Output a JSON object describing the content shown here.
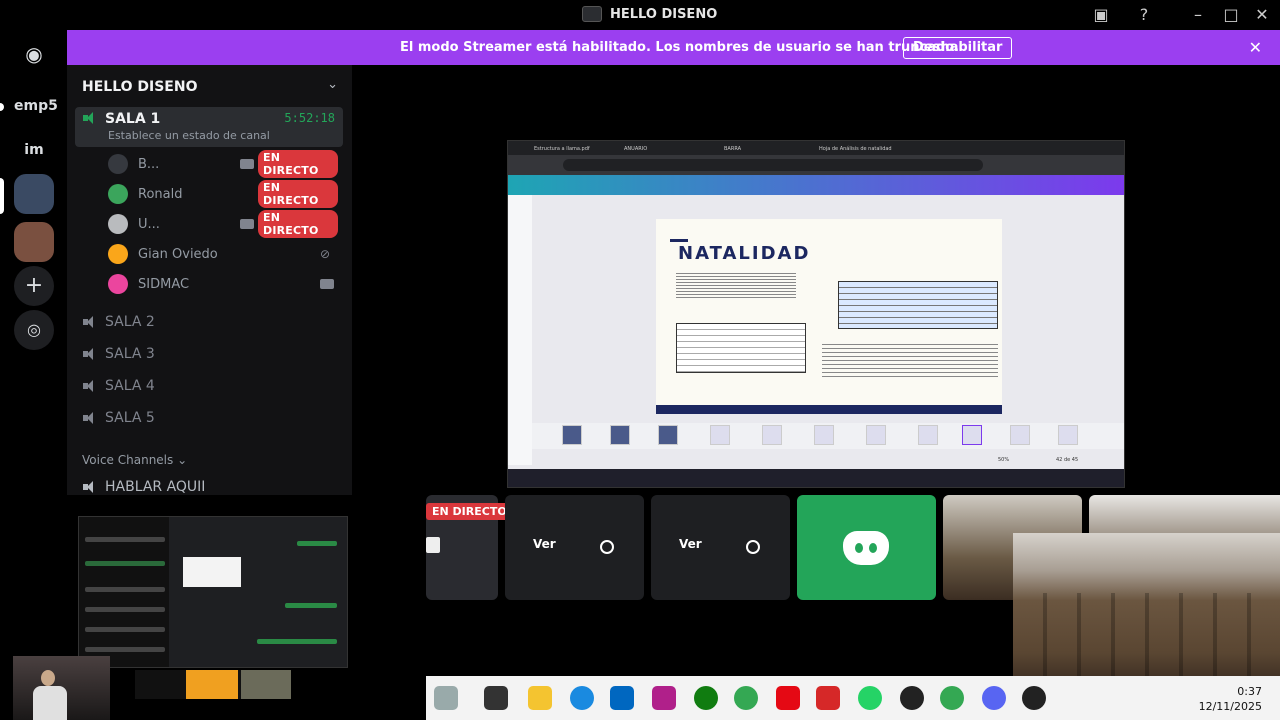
{
  "window": {
    "title": "HELLO DISENO"
  },
  "streamer_banner": {
    "message": "El modo Streamer está habilitado. Los nombres de usuario se han truncado.",
    "button": "Deshabilitar"
  },
  "guilds": [
    {
      "label": "emp5"
    },
    {
      "label": "im"
    }
  ],
  "server": {
    "name": "HELLO DISENO"
  },
  "voice_channels": {
    "active": {
      "name": "SALA 1",
      "timer": "5:52:18",
      "status": "Establece un estado de canal"
    },
    "others": [
      "SALA 2",
      "SALA 3",
      "SALA 4",
      "SALA 5"
    ],
    "category": "Voice Channels",
    "extra": "HABLAR AQUII"
  },
  "users": [
    {
      "name": "B...",
      "live": "EN DIRECTO",
      "avatar_color": "#36393f"
    },
    {
      "name": "Ronald",
      "live": "EN DIRECTO",
      "avatar_color": "#3ba55c"
    },
    {
      "name": "U...",
      "live": "EN DIRECTO",
      "avatar_color": "#b9bbbe"
    },
    {
      "name": "Gian Oviedo",
      "live": "",
      "avatar_color": "#faa61a"
    },
    {
      "name": "SIDMAC",
      "live": "",
      "avatar_color": "#eb459e"
    }
  ],
  "shared_screen": {
    "slide_title": "NATALIDAD",
    "browser_tabs": [
      "Estructura a llama.pdf",
      "ANUARIO",
      "BARRA",
      "Hoja de Análisis de natalidad"
    ],
    "zoom": "50%",
    "pages": "42 de 45"
  },
  "tiles": [
    {
      "live": "EN DIRECTO"
    },
    {
      "label": "Ver"
    },
    {
      "label": "Ver"
    }
  ],
  "taskbar": {
    "time": "0:37",
    "date": "12/11/2025"
  },
  "colors": {
    "accent": "#9b3ff0",
    "live_red": "#da373c",
    "discord_green": "#23a559"
  }
}
